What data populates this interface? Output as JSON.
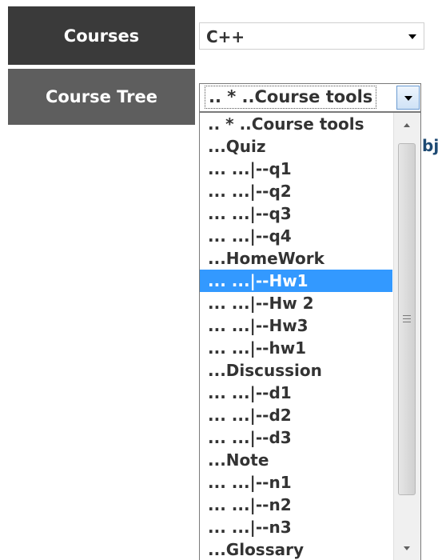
{
  "courses": {
    "label": "Courses",
    "selected": "C++"
  },
  "course_tree": {
    "label": "Course Tree",
    "selected": ".. * ..Course tools",
    "options": [
      ".. * ..Course tools",
      "...Quiz",
      "... ...|--q1",
      "... ...|--q2",
      "... ...|--q3",
      "... ...|--q4",
      "...HomeWork",
      "... ...|--Hw1",
      "... ...|--Hw 2",
      "... ...|--Hw3",
      "... ...|--hw1",
      "...Discussion",
      "... ...|--d1",
      "... ...|--d2",
      "... ...|--d3",
      "...Note",
      "... ...|--n1",
      "... ...|--n2",
      "... ...|--n3",
      "...Glossary"
    ],
    "highlighted": "... ...|--Hw1"
  },
  "partial_text": "bj",
  "colors": {
    "highlight": "#3399ff",
    "label_dark": "#3a3a3a",
    "label_mid": "#5e5e5e"
  }
}
